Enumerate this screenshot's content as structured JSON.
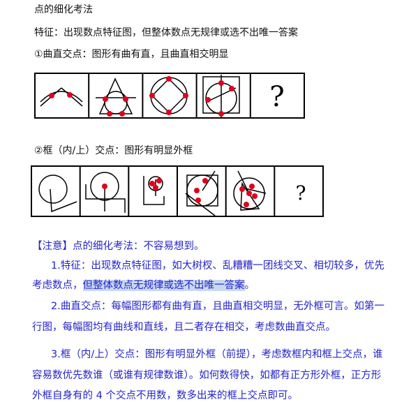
{
  "doc": {
    "title": "点的细化考法",
    "feature": "特征：出现数点特征图，但整体数点无规律或选不出唯一答案",
    "case1": "①曲直交点：图形有曲有直，且曲直相交明显",
    "case2": "②框（内/上）交点：图形有明显外框",
    "question_mark": "?",
    "note": {
      "head": "【注意】点的细化考法：不容易想到。",
      "p1a": "1.特征：出现数点特征图，如大树杈、乱糟糟一团线交叉、相切较多，优先",
      "p1b_plain": "考虑数点，",
      "p1b_highlight": "但整体数点无规律或选不出唯一答案",
      "p1b_end": "。",
      "p2a": "2.曲直交点：每幅图形都有曲有直，且曲直相交明显，无外框可言。如第一",
      "p2b": "行图，每幅图均有曲线和直线，且二者存在相交，考虑数曲直交点。",
      "p3a": "3.框（内/上）交点：图形有明显外框（前提），考虑数框内和框上交点，谁",
      "p3b": "容易数优先数谁（或谁有规律数谁）。如何数得快，如都有正方形外框，正方形",
      "p3c": "外框自身有的 4 个交点不用数，数多出来的框上交点即可。"
    }
  },
  "colors": {
    "dot": "#e0001b",
    "note_text": "#2424c8",
    "highlight": "#c9d7f2"
  }
}
